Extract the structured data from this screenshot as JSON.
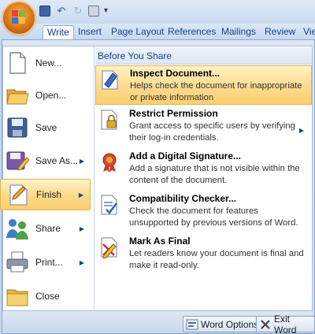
{
  "quick_access": {
    "save_icon": "floppy-disk-icon",
    "undo_icon": "undo-arrow-icon",
    "redo_icon": "redo-arrow-icon",
    "print_icon": "printer-icon",
    "customize_icon": "customize-toolbar-icon"
  },
  "ribbon_tabs": [
    {
      "label": "Write",
      "active": true
    },
    {
      "label": "Insert"
    },
    {
      "label": "Page Layout"
    },
    {
      "label": "References"
    },
    {
      "label": "Mailings"
    },
    {
      "label": "Review"
    },
    {
      "label": "View"
    }
  ],
  "left_menu": [
    {
      "label": "New...",
      "icon": "new-document-icon"
    },
    {
      "label": "Open...",
      "icon": "open-folder-icon"
    },
    {
      "label": "Save",
      "icon": "save-icon"
    },
    {
      "label": "Save As...",
      "icon": "save-as-icon",
      "has_submenu": true
    },
    {
      "label": "Finish",
      "icon": "finish-document-icon",
      "has_submenu": true,
      "selected": true
    },
    {
      "label": "Share",
      "icon": "share-icon",
      "has_submenu": true
    },
    {
      "label": "Print...",
      "icon": "printer-icon",
      "has_submenu": true
    },
    {
      "label": "Close",
      "icon": "close-folder-icon"
    }
  ],
  "submenu": {
    "header": "Before You Share",
    "items": [
      {
        "title": "Inspect Document...",
        "desc": "Helps check the document for inappropriate or private information",
        "icon": "inspect-document-icon",
        "highlighted": true
      },
      {
        "title": "Restrict Permission",
        "desc": "Grant access to specific users by verifying their log-in credentials.",
        "icon": "restrict-permission-icon",
        "has_submenu": true
      },
      {
        "title": "Add a Digital Signature...",
        "desc": "Add a signature that is not visible within the content of the document.",
        "icon": "digital-signature-icon"
      },
      {
        "title": "Compatibility Checker...",
        "desc": "Check the document for features unsupported by previous versions of Word.",
        "icon": "compatibility-checker-icon"
      },
      {
        "title": "Mark As Final",
        "desc": "Let readers know your document is final and make it read-only.",
        "icon": "mark-as-final-icon"
      }
    ]
  },
  "bottom_buttons": {
    "options_label": "Word Options",
    "exit_label": "Exit Word"
  }
}
